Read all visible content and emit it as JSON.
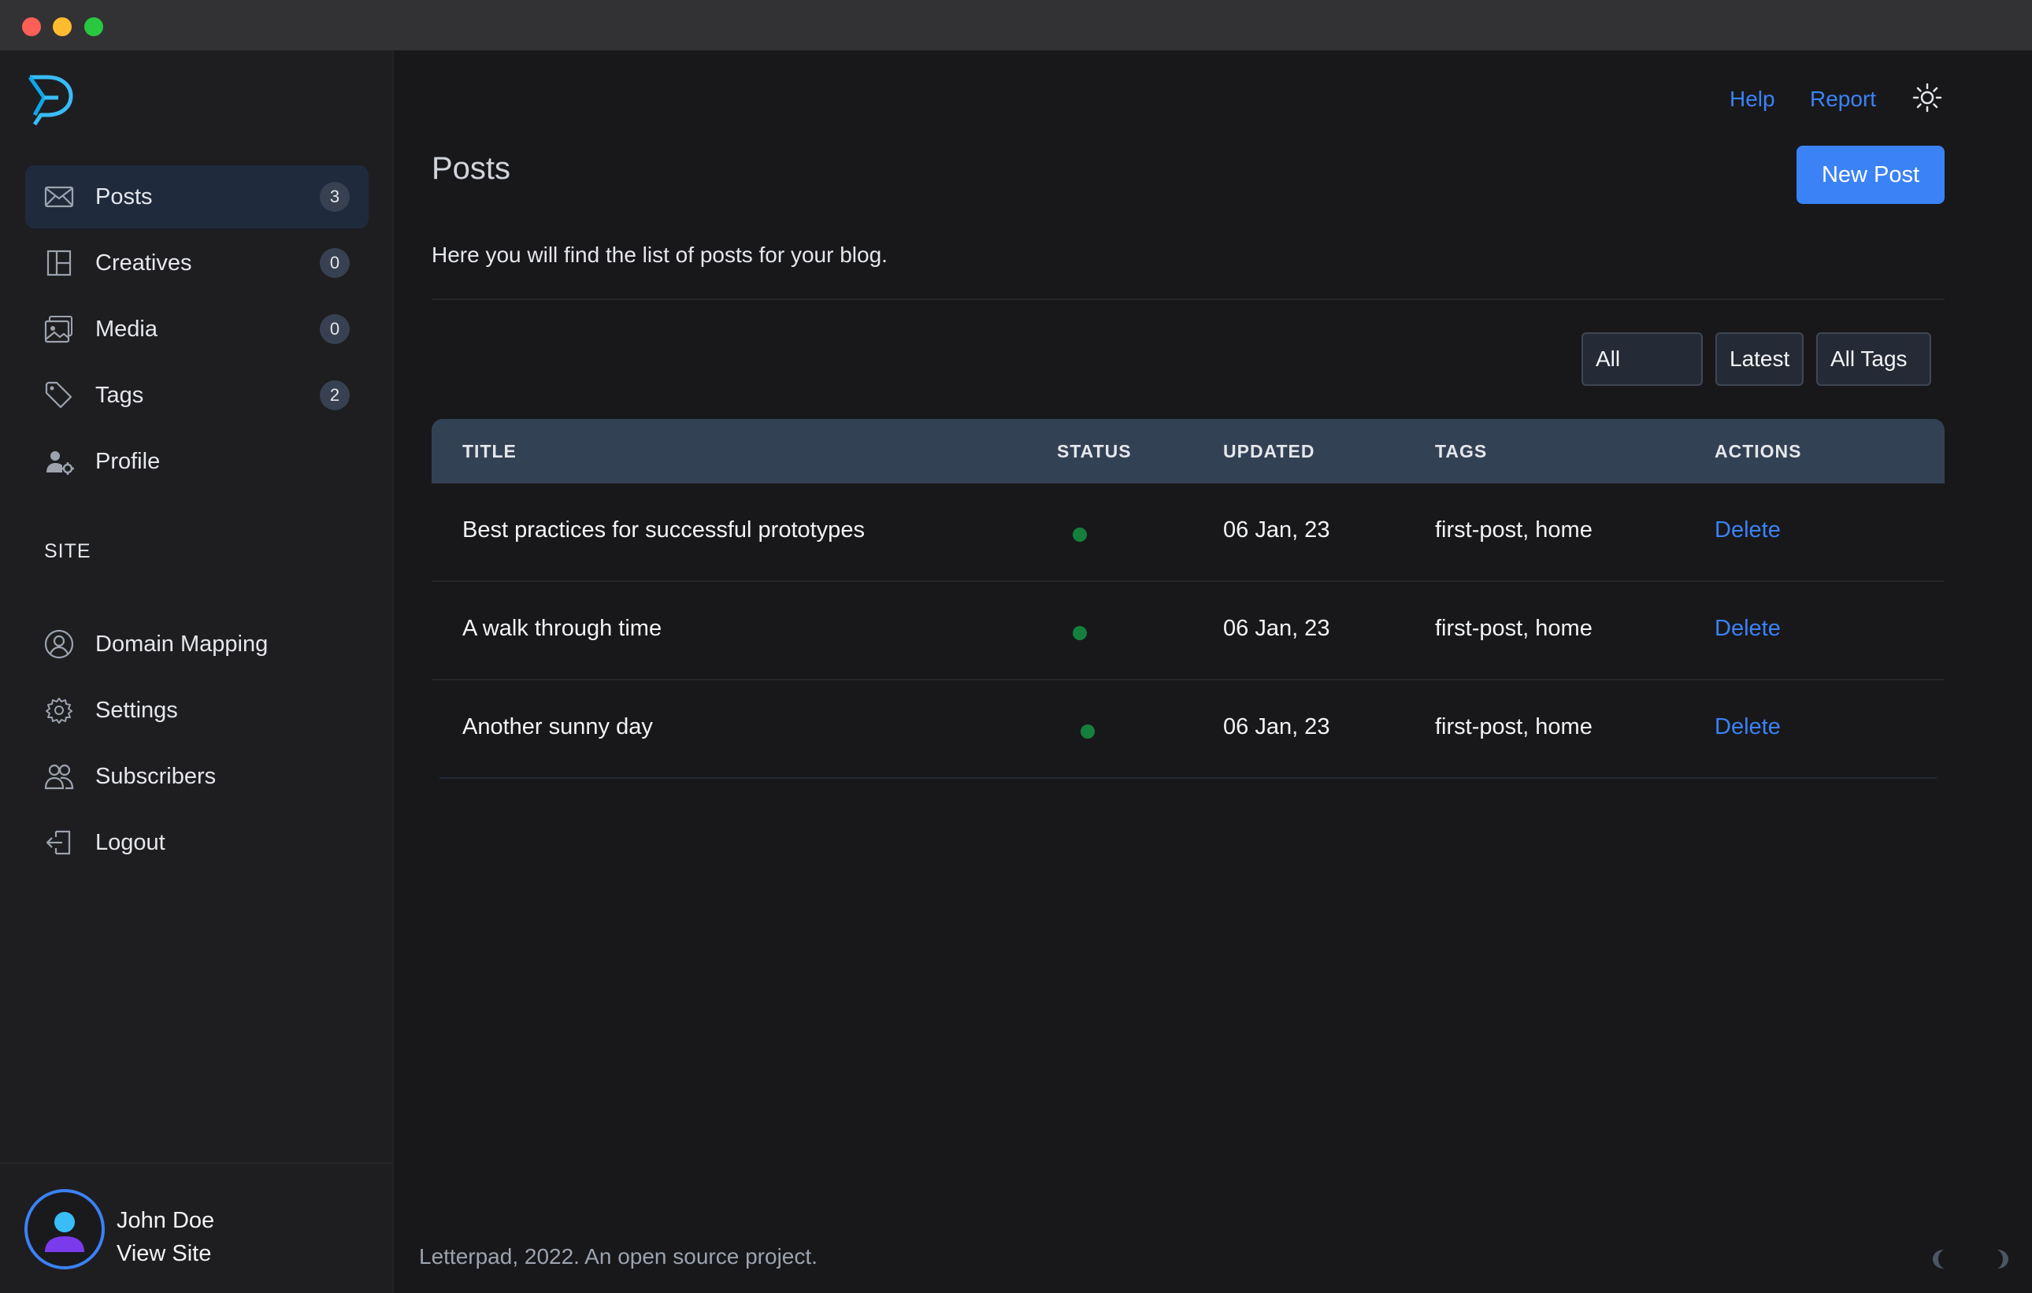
{
  "sidebar": {
    "nav": [
      {
        "label": "Posts",
        "badge": "3",
        "icon": "envelope-icon",
        "active": true
      },
      {
        "label": "Creatives",
        "badge": "0",
        "icon": "layout-icon"
      },
      {
        "label": "Media",
        "badge": "0",
        "icon": "image-icon"
      },
      {
        "label": "Tags",
        "badge": "2",
        "icon": "tag-icon"
      },
      {
        "label": "Profile",
        "icon": "user-cog-icon"
      }
    ],
    "site_section_label": "SITE",
    "site_nav": [
      {
        "label": "Domain Mapping",
        "icon": "user-circle-icon"
      },
      {
        "label": "Settings",
        "icon": "gear-icon"
      },
      {
        "label": "Subscribers",
        "icon": "users-icon"
      },
      {
        "label": "Logout",
        "icon": "logout-icon"
      }
    ],
    "user": {
      "name": "John Doe",
      "link": "View Site"
    }
  },
  "header": {
    "help": "Help",
    "report": "Report",
    "theme_icon": "sun-icon"
  },
  "main": {
    "title": "Posts",
    "new_post": "New Post",
    "description": "Here you will find the list of posts for your blog.",
    "filters": {
      "status": "All",
      "sort": "Latest",
      "tags": "All Tags"
    },
    "table": {
      "columns": [
        "TITLE",
        "STATUS",
        "UPDATED",
        "TAGS",
        "ACTIONS"
      ],
      "rows": [
        {
          "title": "Best practices for successful prototypes",
          "status": "published",
          "updated": "06 Jan, 23",
          "tags": "first-post, home",
          "action": "Delete"
        },
        {
          "title": "A walk through time",
          "status": "published",
          "updated": "06 Jan, 23",
          "tags": "first-post, home",
          "action": "Delete"
        },
        {
          "title": "Another sunny day",
          "status": "published",
          "updated": "06 Jan, 23",
          "tags": "first-post, home",
          "action": "Delete"
        }
      ]
    }
  },
  "footer": {
    "text": "Letterpad, 2022. An open source project."
  },
  "colors": {
    "accent": "#3b82f6",
    "status_published": "#15803d",
    "background": "#18181b",
    "sidebar": "#1e1e21"
  }
}
